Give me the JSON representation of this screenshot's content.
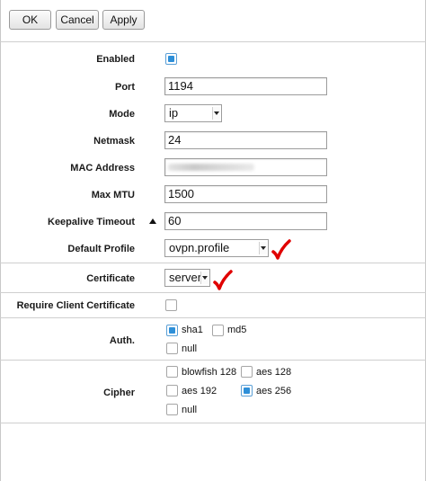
{
  "toolbar": {
    "ok_label": "OK",
    "cancel_label": "Cancel",
    "apply_label": "Apply"
  },
  "form": {
    "enabled": {
      "label": "Enabled",
      "checked": true
    },
    "port": {
      "label": "Port",
      "value": "1194"
    },
    "mode": {
      "label": "Mode",
      "value": "ip"
    },
    "netmask": {
      "label": "Netmask",
      "value": "24"
    },
    "mac_address": {
      "label": "MAC Address",
      "value": ""
    },
    "max_mtu": {
      "label": "Max MTU",
      "value": "1500"
    },
    "keepalive_timeout": {
      "label": "Keepalive Timeout",
      "value": "60"
    },
    "default_profile": {
      "label": "Default Profile",
      "value": "ovpn.profile"
    },
    "certificate": {
      "label": "Certificate",
      "value": "server"
    },
    "require_client_certificate": {
      "label": "Require Client Certificate",
      "checked": false
    },
    "auth": {
      "label": "Auth.",
      "options": [
        {
          "label": "sha1",
          "checked": true
        },
        {
          "label": "md5",
          "checked": false
        },
        {
          "label": "null",
          "checked": false
        }
      ]
    },
    "cipher": {
      "label": "Cipher",
      "options": [
        {
          "label": "blowfish 128",
          "checked": false
        },
        {
          "label": "aes 128",
          "checked": false
        },
        {
          "label": "aes 192",
          "checked": false
        },
        {
          "label": "aes 256",
          "checked": true
        },
        {
          "label": "null",
          "checked": false
        }
      ]
    }
  },
  "colors": {
    "checkbox_fill": "#2e8fd8",
    "annotation_check": "#e00000"
  },
  "icons": [
    "collapse-up-icon",
    "red-checkmark-icon",
    "dropdown-arrow-icon"
  ]
}
